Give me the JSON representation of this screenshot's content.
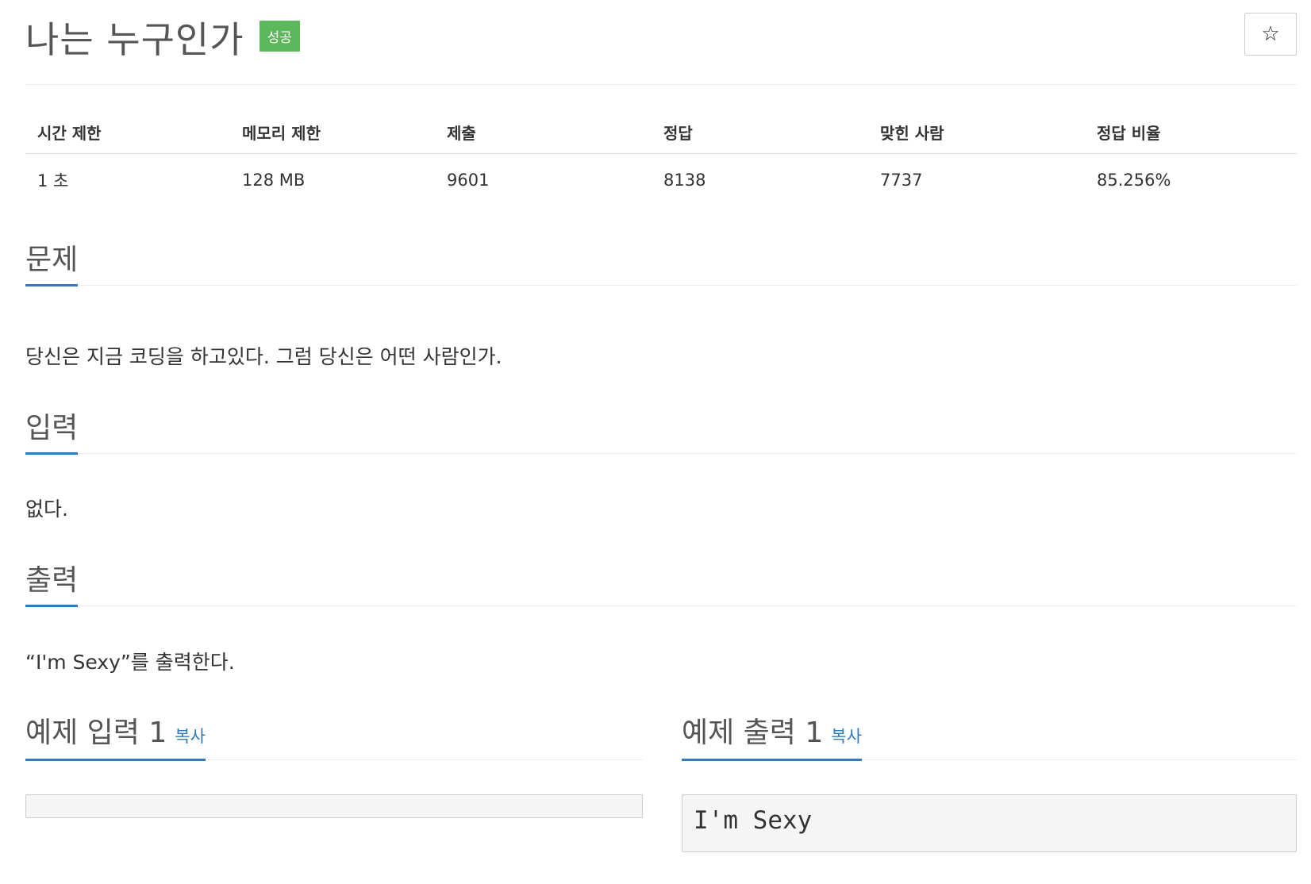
{
  "problem": {
    "title": "나는 누구인가",
    "badge": "성공"
  },
  "stats": {
    "headers": [
      "시간 제한",
      "메모리 제한",
      "제출",
      "정답",
      "맞힌 사람",
      "정답 비율"
    ],
    "values": [
      "1 초",
      "128 MB",
      "9601",
      "8138",
      "7737",
      "85.256%"
    ]
  },
  "sections": {
    "description": {
      "heading": "문제",
      "text": "당신은 지금 코딩을 하고있다. 그럼 당신은 어떤 사람인가."
    },
    "input": {
      "heading": "입력",
      "text": "없다."
    },
    "output": {
      "heading": "출력",
      "text": "“I'm Sexy”를 출력한다."
    }
  },
  "samples": {
    "input": {
      "heading": "예제 입력 1",
      "copy": "복사",
      "content": ""
    },
    "output": {
      "heading": "예제 출력 1",
      "copy": "복사",
      "content": "I'm Sexy"
    }
  },
  "icons": {
    "favorite": "star-icon"
  },
  "colors": {
    "badge": "#5cb85c",
    "accent": "#337ab7"
  }
}
